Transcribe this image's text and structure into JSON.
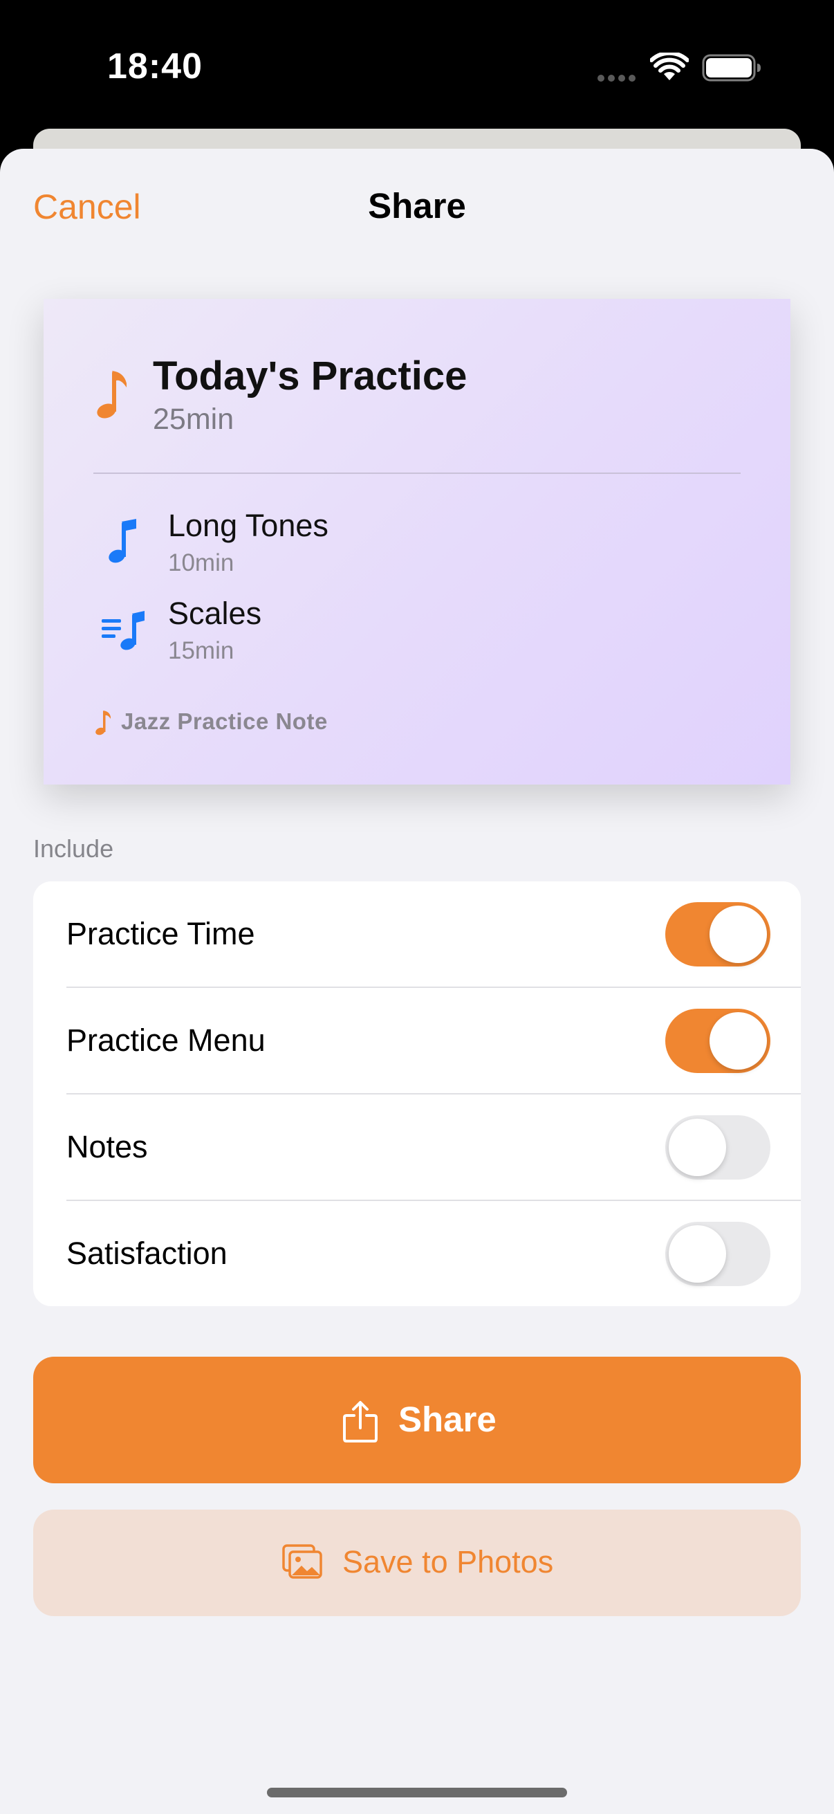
{
  "status_bar": {
    "time": "18:40"
  },
  "header": {
    "cancel_label": "Cancel",
    "title": "Share"
  },
  "preview": {
    "title": "Today's Practice",
    "total_duration": "25min",
    "items": [
      {
        "name": "Long Tones",
        "duration": "10min",
        "icon": "music-note-icon"
      },
      {
        "name": "Scales",
        "duration": "15min",
        "icon": "music-note-list-icon"
      }
    ],
    "footer": "Jazz Practice Note"
  },
  "include": {
    "section_label": "Include",
    "options": [
      {
        "label": "Practice Time",
        "enabled": true
      },
      {
        "label": "Practice Menu",
        "enabled": true
      },
      {
        "label": "Notes",
        "enabled": false
      },
      {
        "label": "Satisfaction",
        "enabled": false
      }
    ]
  },
  "actions": {
    "share_label": "Share",
    "save_label": "Save to Photos"
  },
  "colors": {
    "accent": "#f08631",
    "item_icon": "#1a7af8",
    "card_gradient_start": "#eee9f8",
    "card_gradient_end": "#e0d2fd",
    "save_button_bg": "#f2dfd5"
  }
}
